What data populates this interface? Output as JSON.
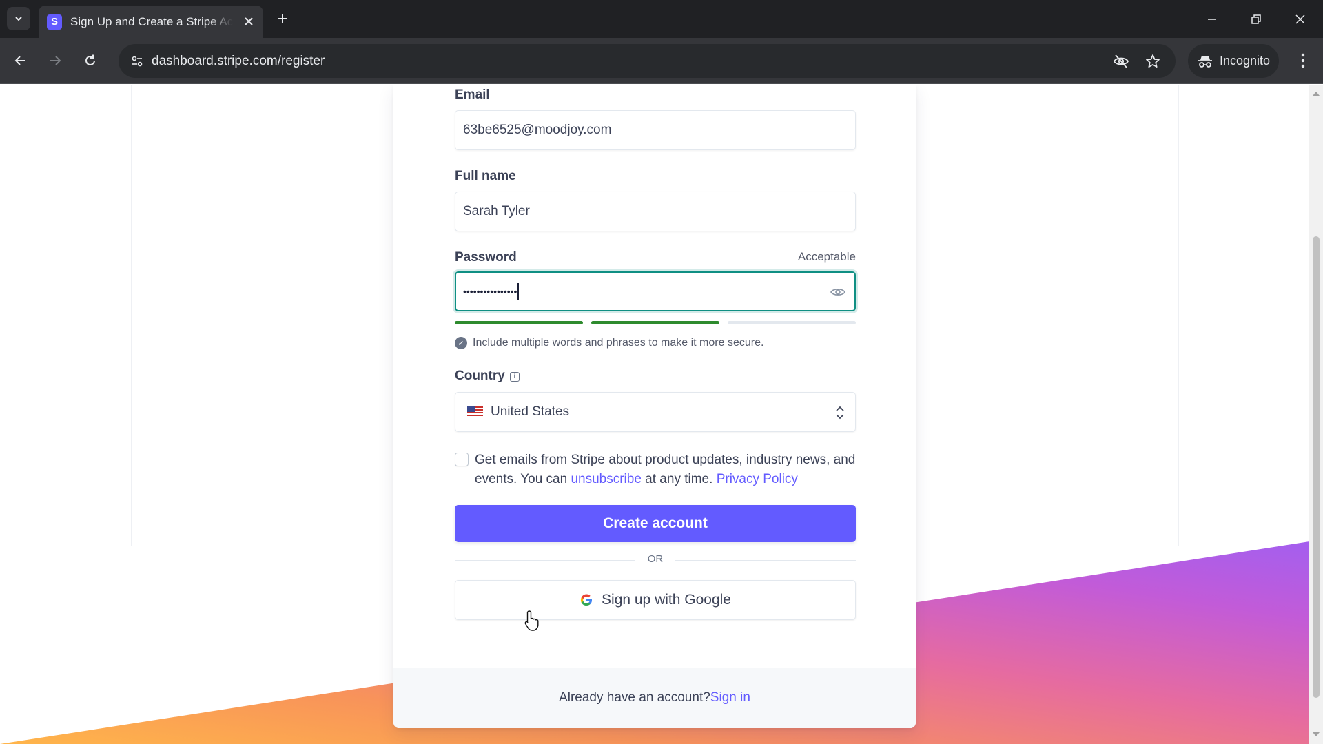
{
  "browser": {
    "tab_title": "Sign Up and Create a Stripe Account",
    "favicon_letter": "S",
    "url": "dashboard.stripe.com/register",
    "incognito_label": "Incognito"
  },
  "form": {
    "email": {
      "label": "Email",
      "value": "63be6525@moodjoy.com"
    },
    "full_name": {
      "label": "Full name",
      "value": "Sarah Tyler"
    },
    "password": {
      "label": "Password",
      "value_masked": "••••••••••••••••",
      "strength_label": "Acceptable",
      "strength_segments_filled": 2,
      "strength_segments_total": 3,
      "hint": "Include multiple words and phrases to make it more secure."
    },
    "country": {
      "label": "Country",
      "info_icon": "i",
      "value": "United States"
    },
    "consent": {
      "text_before": "Get emails from Stripe about product updates, industry news, and events. You can ",
      "unsubscribe_link": "unsubscribe",
      "text_middle": " at any time. ",
      "privacy_link": "Privacy Policy",
      "checked": false
    },
    "create_button": "Create account",
    "divider": "OR",
    "google_button": "Sign up with Google"
  },
  "footer": {
    "text": "Already have an account? ",
    "sign_in_link": "Sign in"
  },
  "colors": {
    "brand": "#635bff",
    "strength_good": "#2e8b2e",
    "focus_ring": "#0f8f83"
  },
  "icons": [
    "tab-list-icon",
    "close-icon",
    "plus-icon",
    "minimize-icon",
    "restore-icon",
    "back-icon",
    "forward-icon",
    "reload-icon",
    "site-settings-icon",
    "eye-off-icon",
    "star-icon",
    "incognito-icon",
    "kebab-menu-icon",
    "eye-icon",
    "check-circle-icon",
    "info-icon",
    "us-flag-icon",
    "chevron-updown-icon",
    "google-icon",
    "cursor-icon"
  ]
}
